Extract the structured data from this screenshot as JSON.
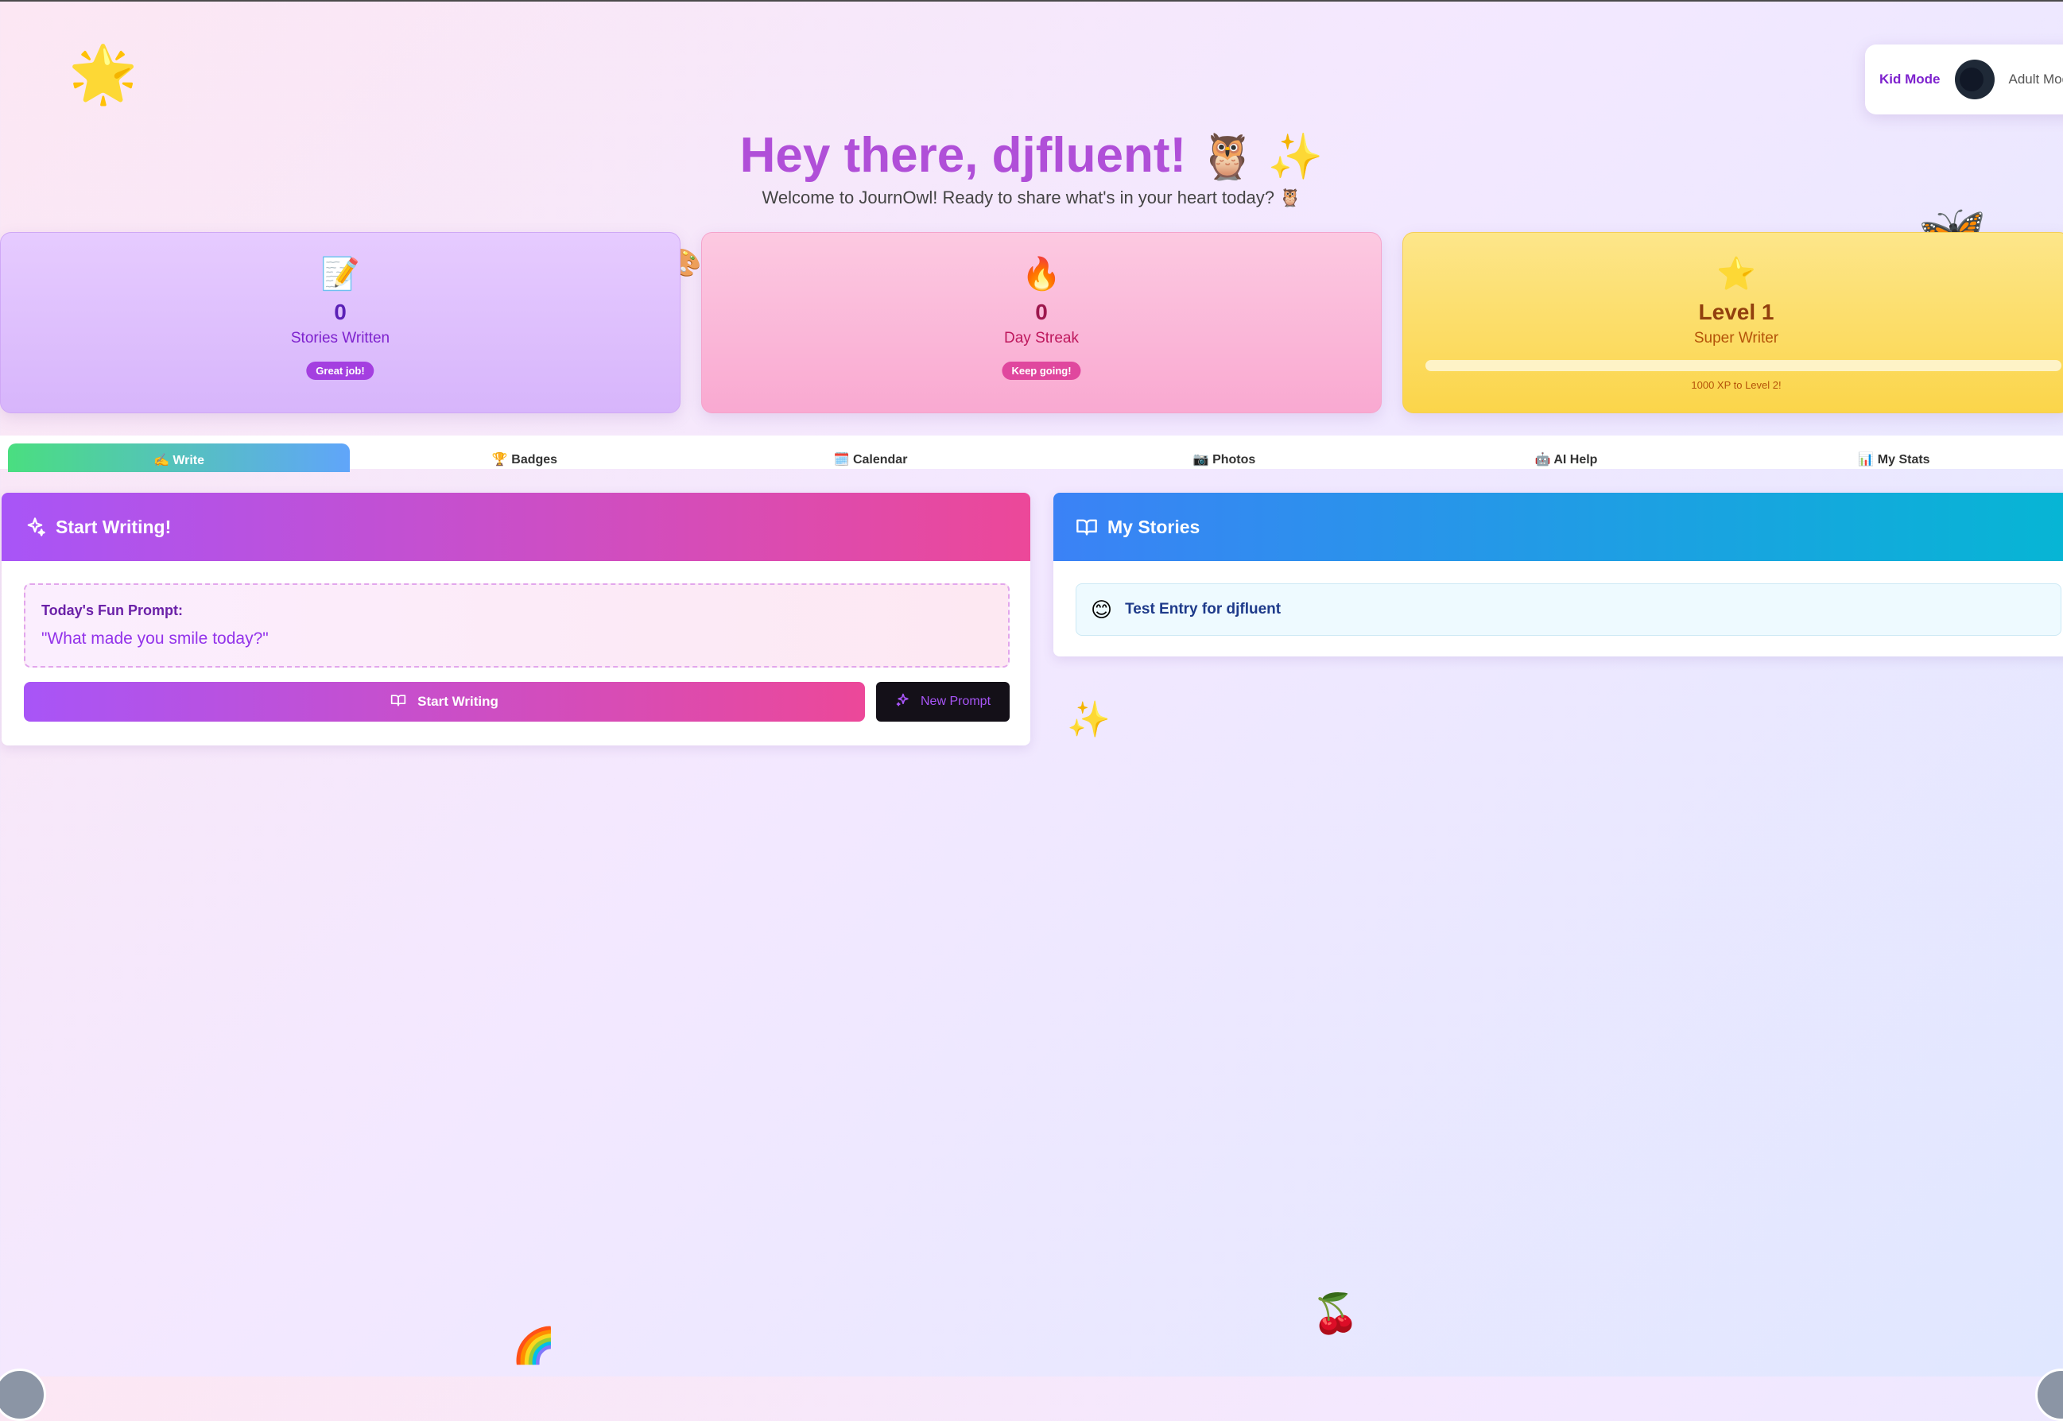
{
  "header": {
    "greeting": "Hey there, djfluent!",
    "greeting_emojis": "🦉 ✨",
    "subtitle": "Welcome to JournOwl! Ready to share what's in your heart today? 🦉"
  },
  "mode_toggle": {
    "kid_label": "Kid Mode",
    "adult_label": "Adult Mode",
    "selected": "Kid Mode"
  },
  "stats": {
    "stories": {
      "icon": "📝",
      "value": "0",
      "label": "Stories Written",
      "badge": "Great job!"
    },
    "streak": {
      "icon": "🔥",
      "value": "0",
      "label": "Day Streak",
      "badge": "Keep going!"
    },
    "level": {
      "icon": "⭐",
      "value": "Level 1",
      "label": "Super Writer",
      "xp_text": "1000 XP to Level 2!",
      "xp_progress_percent": 0
    }
  },
  "tabs": [
    {
      "label": "✍️ Write",
      "active": true
    },
    {
      "label": "🏆 Badges",
      "active": false
    },
    {
      "label": "🗓️ Calendar",
      "active": false
    },
    {
      "label": "📷 Photos",
      "active": false
    },
    {
      "label": "🤖 AI Help",
      "active": false
    },
    {
      "label": "📊 My Stats",
      "active": false
    }
  ],
  "write_panel": {
    "title": "Start Writing!",
    "prompt_label": "Today's Fun Prompt:",
    "prompt_text": "\"What made you smile today?\"",
    "start_button": "Start Writing",
    "new_prompt_button": "New Prompt"
  },
  "stories_panel": {
    "title": "My Stories",
    "entries": [
      {
        "emoji": "😊",
        "title": "Test Entry for djfluent"
      }
    ]
  },
  "decorations": {
    "star": "🌟",
    "sparkles": "✨",
    "palette": "🎨",
    "butterfly": "🦋",
    "cherry": "🍒",
    "rainbow": "🌈"
  },
  "icons": [
    "sparkles-icon",
    "book-open-icon",
    "wand-sparkles-icon"
  ],
  "colors": {
    "purple": "#a855f7",
    "pink": "#ec4899",
    "blue": "#3b82f6",
    "cyan": "#06b6d4",
    "yellow": "#fbd54a"
  }
}
